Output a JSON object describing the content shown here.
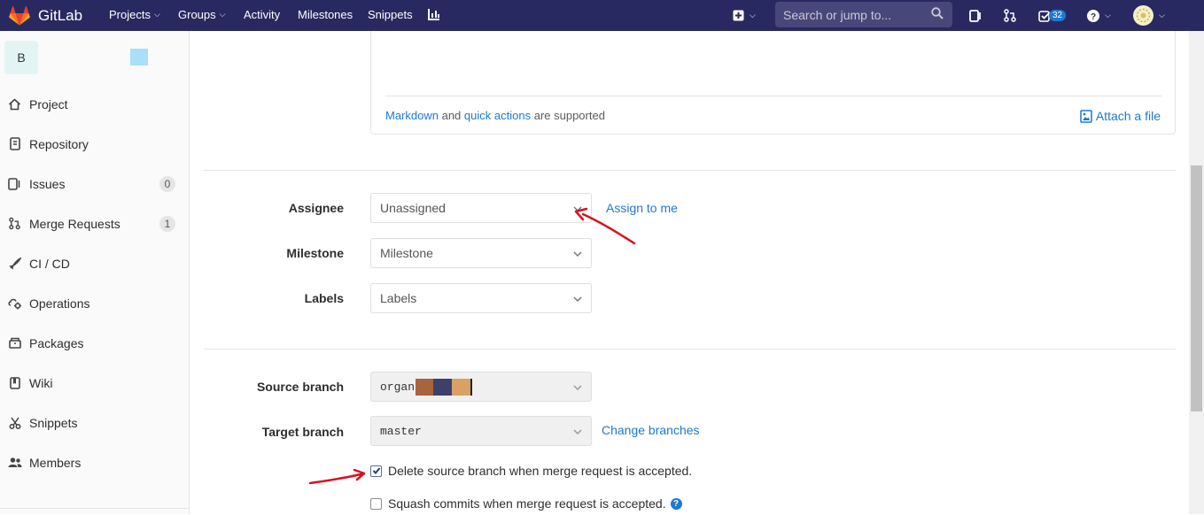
{
  "navbar": {
    "brand": "GitLab",
    "menu": [
      "Projects",
      "Groups",
      "Activity",
      "Milestones",
      "Snippets"
    ],
    "search_placeholder": "Search or jump to...",
    "todos_count": "32"
  },
  "sidebar": {
    "project_initial": "B",
    "items": [
      {
        "label": "Project",
        "icon": "home-icon"
      },
      {
        "label": "Repository",
        "icon": "repository-icon"
      },
      {
        "label": "Issues",
        "icon": "issues-icon",
        "count": "0"
      },
      {
        "label": "Merge Requests",
        "icon": "merge-request-icon",
        "count": "1"
      },
      {
        "label": "CI / CD",
        "icon": "rocket-icon"
      },
      {
        "label": "Operations",
        "icon": "cloud-gear-icon"
      },
      {
        "label": "Packages",
        "icon": "package-icon"
      },
      {
        "label": "Wiki",
        "icon": "book-icon"
      },
      {
        "label": "Snippets",
        "icon": "scissors-icon"
      },
      {
        "label": "Members",
        "icon": "users-icon"
      }
    ]
  },
  "editor": {
    "hint_link1": "Markdown",
    "hint_and": "and",
    "hint_link2": "quick actions",
    "hint_suffix": "are supported",
    "attach_label": "Attach a file"
  },
  "form": {
    "assignee_label": "Assignee",
    "assignee_value": "Unassigned",
    "assign_to_me": "Assign to me",
    "milestone_label": "Milestone",
    "milestone_value": "Milestone",
    "labels_label": "Labels",
    "labels_value": "Labels",
    "source_branch_label": "Source branch",
    "source_branch_value": "organ",
    "target_branch_label": "Target branch",
    "target_branch_value": "master",
    "change_branches": "Change branches",
    "delete_source_label": "Delete source branch when merge request is accepted.",
    "delete_source_checked": true,
    "squash_label": "Squash commits when merge request is accepted.",
    "squash_checked": false
  },
  "colors": {
    "navbar": "#292961",
    "link": "#1f78d1",
    "annotation": "#d9121f"
  }
}
